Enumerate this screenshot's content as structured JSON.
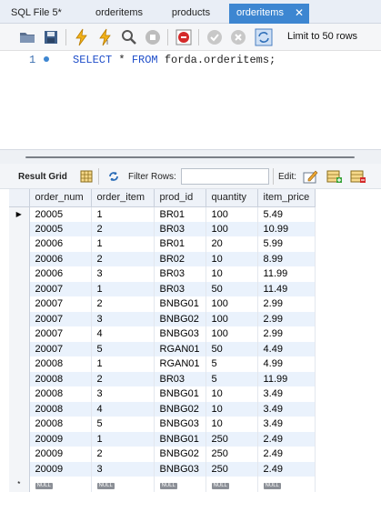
{
  "tabs": [
    {
      "label": "SQL File 5*",
      "active": false
    },
    {
      "label": "orderitems",
      "active": false
    },
    {
      "label": "products",
      "active": false
    },
    {
      "label": "orderitems",
      "active": true
    }
  ],
  "query_toolbar": {
    "icons": [
      "open-folder-icon",
      "save-icon",
      "execute-icon",
      "execute-selection-icon",
      "explain-icon",
      "stop-icon",
      "toggle-error-icon",
      "commit-icon",
      "rollback-icon",
      "autocommit-icon"
    ],
    "limit_label": "Limit to 50 rows"
  },
  "editor": {
    "line_number": "1",
    "sql_keyword_select": "SELECT",
    "sql_star": " * ",
    "sql_keyword_from": "FROM",
    "sql_rest": " forda.orderitems;"
  },
  "result_toolbar": {
    "result_grid_label": "Result Grid",
    "filter_label": "Filter Rows:",
    "filter_value": "",
    "edit_label": "Edit:"
  },
  "grid": {
    "columns": [
      "order_num",
      "order_item",
      "prod_id",
      "quantity",
      "item_price"
    ],
    "rows": [
      [
        "20005",
        "1",
        "BR01",
        "100",
        "5.49"
      ],
      [
        "20005",
        "2",
        "BR03",
        "100",
        "10.99"
      ],
      [
        "20006",
        "1",
        "BR01",
        "20",
        "5.99"
      ],
      [
        "20006",
        "2",
        "BR02",
        "10",
        "8.99"
      ],
      [
        "20006",
        "3",
        "BR03",
        "10",
        "11.99"
      ],
      [
        "20007",
        "1",
        "BR03",
        "50",
        "11.49"
      ],
      [
        "20007",
        "2",
        "BNBG01",
        "100",
        "2.99"
      ],
      [
        "20007",
        "3",
        "BNBG02",
        "100",
        "2.99"
      ],
      [
        "20007",
        "4",
        "BNBG03",
        "100",
        "2.99"
      ],
      [
        "20007",
        "5",
        "RGAN01",
        "50",
        "4.49"
      ],
      [
        "20008",
        "1",
        "RGAN01",
        "5",
        "4.99"
      ],
      [
        "20008",
        "2",
        "BR03",
        "5",
        "11.99"
      ],
      [
        "20008",
        "3",
        "BNBG01",
        "10",
        "3.49"
      ],
      [
        "20008",
        "4",
        "BNBG02",
        "10",
        "3.49"
      ],
      [
        "20008",
        "5",
        "BNBG03",
        "10",
        "3.49"
      ],
      [
        "20009",
        "1",
        "BNBG01",
        "250",
        "2.49"
      ],
      [
        "20009",
        "2",
        "BNBG02",
        "250",
        "2.49"
      ],
      [
        "20009",
        "3",
        "BNBG03",
        "250",
        "2.49"
      ]
    ],
    "null_label": "NULL",
    "current_row_marker": "▶",
    "new_row_marker": "*"
  }
}
